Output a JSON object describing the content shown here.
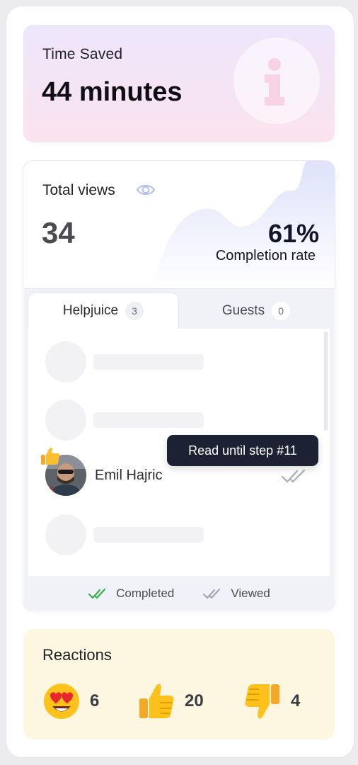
{
  "time_saved": {
    "label": "Time Saved",
    "value": "44 minutes",
    "icon": "info-icon"
  },
  "views": {
    "label": "Total views",
    "icon": "eye-icon",
    "count": "34",
    "completion_rate": "61%",
    "completion_label": "Completion rate"
  },
  "tabs": [
    {
      "label": "Helpjuice",
      "count": "3",
      "active": true
    },
    {
      "label": "Guests",
      "count": "0",
      "active": false
    }
  ],
  "list": {
    "user": {
      "name": "Emil Hajric",
      "badge_icon": "thumbs-up-icon",
      "status_icon": "double-check-icon"
    },
    "tooltip": "Read until step #11"
  },
  "legend": {
    "completed": "Completed",
    "viewed": "Viewed",
    "completed_color": "#38b04a",
    "viewed_color": "#a4a8b2"
  },
  "reactions": {
    "title": "Reactions",
    "items": [
      {
        "icon": "heart-eyes-icon",
        "count": "6"
      },
      {
        "icon": "thumbs-up-icon",
        "count": "20"
      },
      {
        "icon": "thumbs-down-icon",
        "count": "4"
      }
    ]
  }
}
